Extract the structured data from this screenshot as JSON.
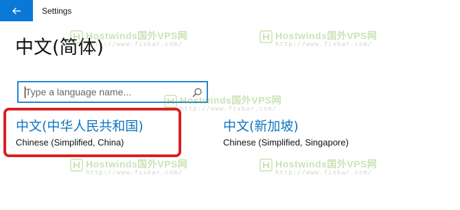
{
  "window": {
    "title": "Settings",
    "back_icon": "back-arrow-icon",
    "accent_color": "#0a78d7"
  },
  "page": {
    "title": "中文(简体)"
  },
  "search": {
    "placeholder": "Type a language name...",
    "value": "",
    "icon": "search-icon"
  },
  "variants": [
    {
      "name": "中文(中华人民共和国)",
      "description": "Chinese (Simplified, China)",
      "highlighted": true
    },
    {
      "name": "中文(新加坡)",
      "description": "Chinese (Simplified, Singapore)",
      "highlighted": false
    }
  ],
  "highlight": {
    "color": "#d9201f"
  },
  "watermark": {
    "text": "Hostwinds国外VPS网",
    "url": "http://www.fixbar.com/"
  }
}
